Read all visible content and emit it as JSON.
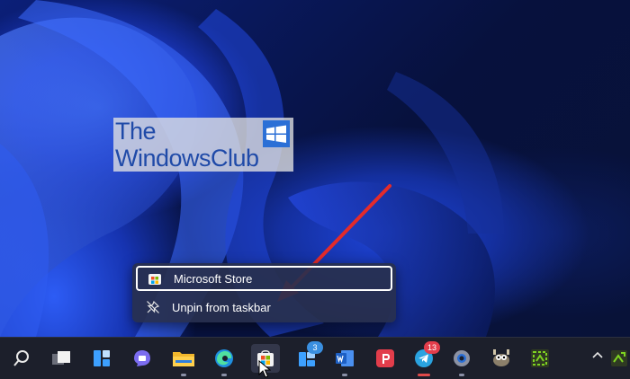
{
  "watermark": {
    "line1": "The",
    "line2": "WindowsClub"
  },
  "context_menu": {
    "app_name": "Microsoft Store",
    "unpin_label": "Unpin from taskbar"
  },
  "taskbar": {
    "badges": {
      "widgets_count": "3",
      "telegram_count": "13"
    }
  },
  "colors": {
    "accent_red": "#e32b2b",
    "menu_bg": "#28304e",
    "taskbar_bg": "#1c1f2b"
  }
}
